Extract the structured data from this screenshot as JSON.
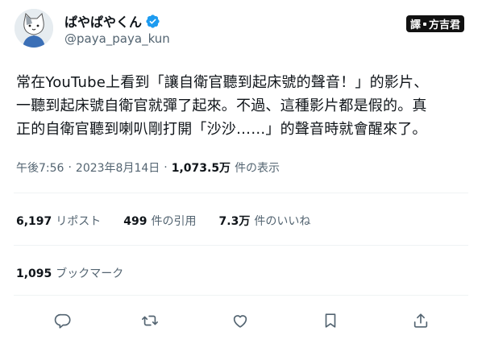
{
  "author": {
    "display_name": "ぱやぱやくん",
    "handle": "@paya_paya_kun",
    "verified": true
  },
  "badge": {
    "left": "譯",
    "right": "方吉君"
  },
  "tweet": {
    "lines": [
      "常在YouTube上看到「讓自衛官聽到起床號的聲音！」的影片、",
      "一聽到起床號自衛官就彈了起來。不過、這種影片都是假的。真",
      "正的自衛官聽到喇叭剛打開「沙沙……」的聲音時就會醒來了。"
    ]
  },
  "meta": {
    "time": "午後7:56",
    "date": "2023年8月14日",
    "separator": "·",
    "views_count": "1,073.5万",
    "views_label": "件の表示"
  },
  "stats": {
    "reposts_count": "6,197",
    "reposts_label": "リポスト",
    "quotes_count": "499",
    "quotes_label": "件の引用",
    "likes_count": "7.3万",
    "likes_label": "件のいいね"
  },
  "bookmarks": {
    "count": "1,095",
    "label": "ブックマーク"
  },
  "icons": {
    "reply": "reply-icon",
    "retweet": "retweet-icon",
    "like": "like-icon",
    "bookmark": "bookmark-icon",
    "share": "share-icon",
    "verified": "verified-icon"
  },
  "colors": {
    "verified": "#1d9bf0",
    "secondary_text": "#536471",
    "action_icons": "#536471"
  }
}
